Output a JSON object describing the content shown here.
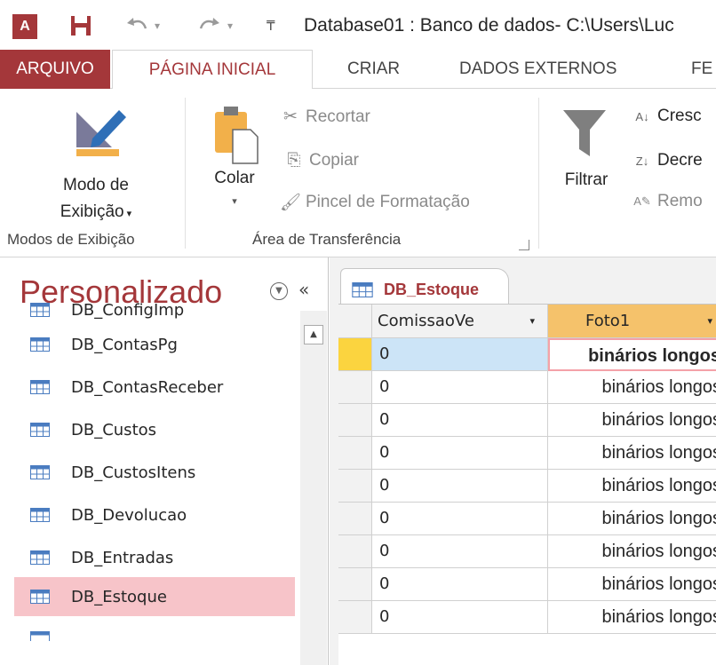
{
  "titlebar": {
    "app_icon_text": "A",
    "title": "Database01 : Banco de dados- C:\\Users\\Luc",
    "icons": [
      "access-app-icon",
      "save-icon",
      "undo-icon",
      "redo-icon",
      "customize-qat-icon"
    ]
  },
  "tabs": [
    {
      "label": "ARQUIVO"
    },
    {
      "label": "PÁGINA INICIAL"
    },
    {
      "label": "CRIAR"
    },
    {
      "label": "DADOS EXTERNOS"
    },
    {
      "label": "FE"
    }
  ],
  "ribbon": {
    "views": {
      "button_line1": "Modo de",
      "button_line2": "Exibição",
      "group_label": "Modos de Exibição"
    },
    "clipboard": {
      "paste_label": "Colar",
      "cut_label": "Recortar",
      "copy_label": "Copiar",
      "format_painter_label": "Pincel de Formatação",
      "group_label": "Área de Transferência"
    },
    "sort_filter": {
      "filter_label": "Filtrar",
      "ascending_label": "Cresc",
      "descending_label": "Decre",
      "remove_sort_label": "Remo"
    }
  },
  "nav": {
    "header": "Personalizado",
    "items": [
      {
        "label": "DB_ConfigImp"
      },
      {
        "label": "DB_ContasPg"
      },
      {
        "label": "DB_ContasReceber"
      },
      {
        "label": "DB_Custos"
      },
      {
        "label": "DB_CustosItens"
      },
      {
        "label": "DB_Devolucao"
      },
      {
        "label": "DB_Entradas"
      },
      {
        "label": "DB_Estoque"
      }
    ],
    "selected": "DB_Estoque"
  },
  "document": {
    "tab_label": "DB_Estoque",
    "columns": [
      "ComissaoVe",
      "Foto1"
    ],
    "rows": [
      {
        "c1": "0",
        "c2": "binários longos"
      },
      {
        "c1": "0",
        "c2": "binários longos"
      },
      {
        "c1": "0",
        "c2": "binários longos"
      },
      {
        "c1": "0",
        "c2": "binários longos"
      },
      {
        "c1": "0",
        "c2": "binários longos"
      },
      {
        "c1": "0",
        "c2": "binários longos"
      },
      {
        "c1": "0",
        "c2": "binários longos"
      },
      {
        "c1": "0",
        "c2": "binários longos"
      },
      {
        "c1": "0",
        "c2": "binários longos"
      }
    ]
  },
  "colors": {
    "accent": "#a4373a",
    "selected_nav": "#f7c4c9",
    "header_highlight": "#f5c26b",
    "current_record": "#fbd43f"
  }
}
